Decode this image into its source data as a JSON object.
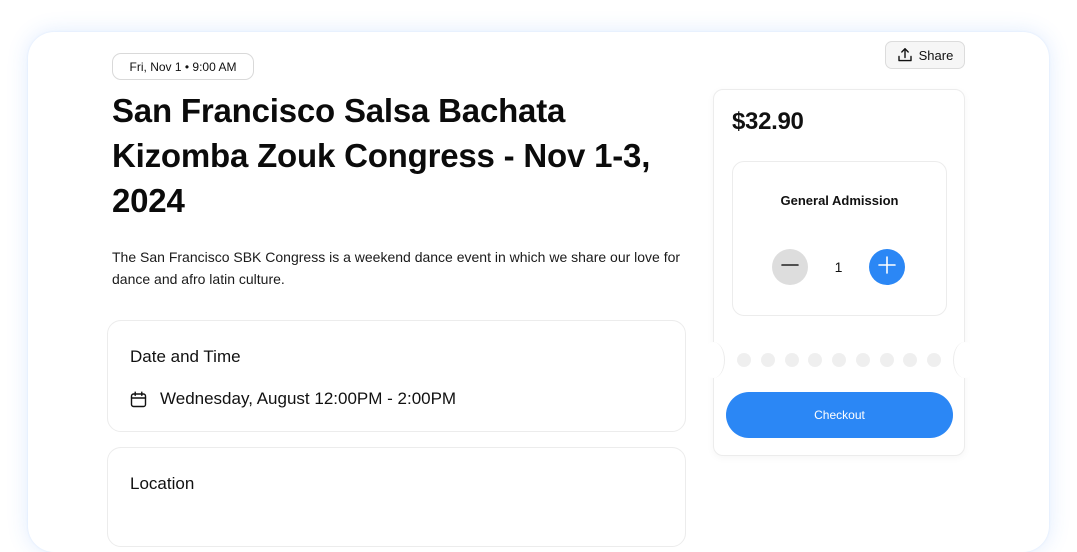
{
  "event": {
    "date_pill": "Fri, Nov 1 • 9:00 AM",
    "title": "San Francisco Salsa Bachata Kizomba Zouk Congress - Nov 1-3, 2024",
    "description": "The San Francisco SBK Congress is a weekend dance event in which we share our love for dance and afro latin culture."
  },
  "header": {
    "share_label": "Share",
    "share_icon": "share-upload-icon"
  },
  "date_time_card": {
    "heading": "Date and Time",
    "icon": "calendar-icon",
    "value": "Wednesday, August 12:00PM - 2:00PM"
  },
  "location_card": {
    "heading": "Location"
  },
  "ticket": {
    "price": "$32.90",
    "admission_label": "General Admission",
    "quantity": "1",
    "minus_icon": "minus-icon",
    "plus_icon": "plus-icon",
    "checkout_label": "Checkout"
  },
  "colors": {
    "accent": "#2b87f5",
    "stepper_minus_bg": "#dddddd",
    "glow": "#3b82f6"
  }
}
